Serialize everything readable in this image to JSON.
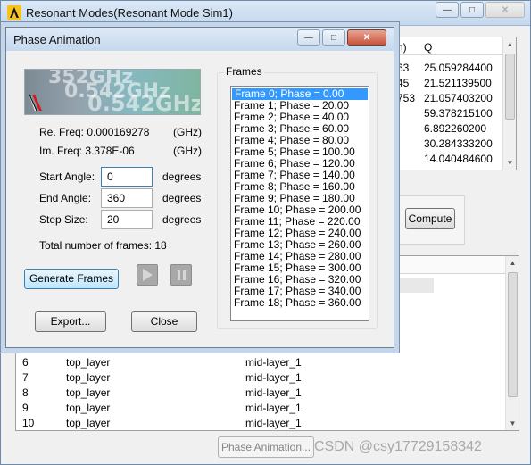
{
  "back_window": {
    "title": "Resonant Modes(Resonant Mode Sim1)",
    "results_table": {
      "headers": [
        "n)",
        "Q"
      ],
      "rows": [
        {
          "c1": "63",
          "q": "25.059284400"
        },
        {
          "c1": "45",
          "q": "21.521139500"
        },
        {
          "c1": "753",
          "q": "21.057403200"
        },
        {
          "c1": "",
          "q": "59.378215100"
        },
        {
          "c1": "",
          "q": "6.892260200"
        },
        {
          "c1": "",
          "q": "30.284333200"
        },
        {
          "c1": "",
          "q": "14.040484600"
        }
      ]
    },
    "compute_label": "Compute",
    "layer_rows": [
      {
        "n": "6",
        "a": "top_layer",
        "b": "mid-layer_1"
      },
      {
        "n": "7",
        "a": "top_layer",
        "b": "mid-layer_1"
      },
      {
        "n": "8",
        "a": "top_layer",
        "b": "mid-layer_1"
      },
      {
        "n": "9",
        "a": "top_layer",
        "b": "mid-layer_1"
      },
      {
        "n": "10",
        "a": "top_layer",
        "b": "mid-layer_1"
      }
    ],
    "phase_animation_label": "Phase Animation...",
    "watermark": "CSDN @csy17729158342"
  },
  "dialog": {
    "title": "Phase Animation",
    "preview_text": [
      "352GHz",
      "0.542GHz",
      "0.542GHz"
    ],
    "re_freq_label": "Re. Freq: 0.000169278",
    "re_freq_unit": "(GHz)",
    "im_freq_label": "Im. Freq: 3.378E-06",
    "im_freq_unit": "(GHz)",
    "start_angle_label": "Start Angle:",
    "start_angle_value": "0",
    "end_angle_label": "End Angle:",
    "end_angle_value": "360",
    "step_size_label": "Step Size:",
    "step_size_value": "20",
    "unit_degrees": "degrees",
    "total_frames_label": "Total number of frames: 18",
    "generate_label": "Generate Frames",
    "export_label": "Export...",
    "close_label": "Close",
    "frames_group_title": "Frames",
    "frames": [
      "Frame 0; Phase = 0.00",
      "Frame 1; Phase = 20.00",
      "Frame 2; Phase = 40.00",
      "Frame 3; Phase = 60.00",
      "Frame 4; Phase = 80.00",
      "Frame 5; Phase = 100.00",
      "Frame 6; Phase = 120.00",
      "Frame 7; Phase = 140.00",
      "Frame 8; Phase = 160.00",
      "Frame 9; Phase = 180.00",
      "Frame 10; Phase = 200.00",
      "Frame 11; Phase = 220.00",
      "Frame 12; Phase = 240.00",
      "Frame 13; Phase = 260.00",
      "Frame 14; Phase = 280.00",
      "Frame 15; Phase = 300.00",
      "Frame 16; Phase = 320.00",
      "Frame 17; Phase = 340.00",
      "Frame 18; Phase = 360.00"
    ],
    "selected_frame_index": 0
  }
}
